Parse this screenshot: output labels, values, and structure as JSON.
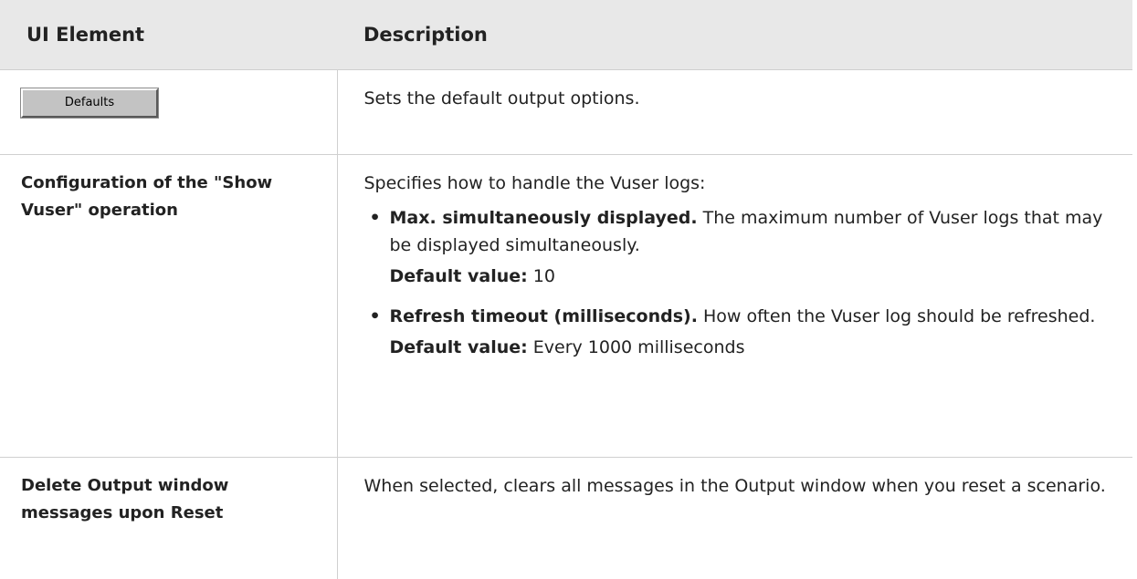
{
  "header": {
    "col_element": "UI Element",
    "col_description": "Description"
  },
  "rows": {
    "defaults": {
      "button_label": "Defaults",
      "description": "Sets the default output options."
    },
    "show_vuser": {
      "element": "Configuration of the \"Show Vuser\" operation",
      "intro": "Specifies how to handle the Vuser logs:",
      "options": [
        {
          "bullet": "•",
          "term": "Max. simultaneously displayed.",
          "text": " The maximum number of Vuser logs that may be displayed simultaneously.",
          "default_label": "Default value:",
          "default_value": " 10"
        },
        {
          "bullet": "•",
          "term": "Refresh timeout (milliseconds).",
          "text": " How often the Vuser log should be refreshed.",
          "default_label": "Default value:",
          "default_value": " Every 1000 milliseconds"
        }
      ]
    },
    "delete_output": {
      "element": "Delete Output window messages upon Reset",
      "description": "When selected, clears all messages in the Output window when you reset a scenario."
    }
  }
}
